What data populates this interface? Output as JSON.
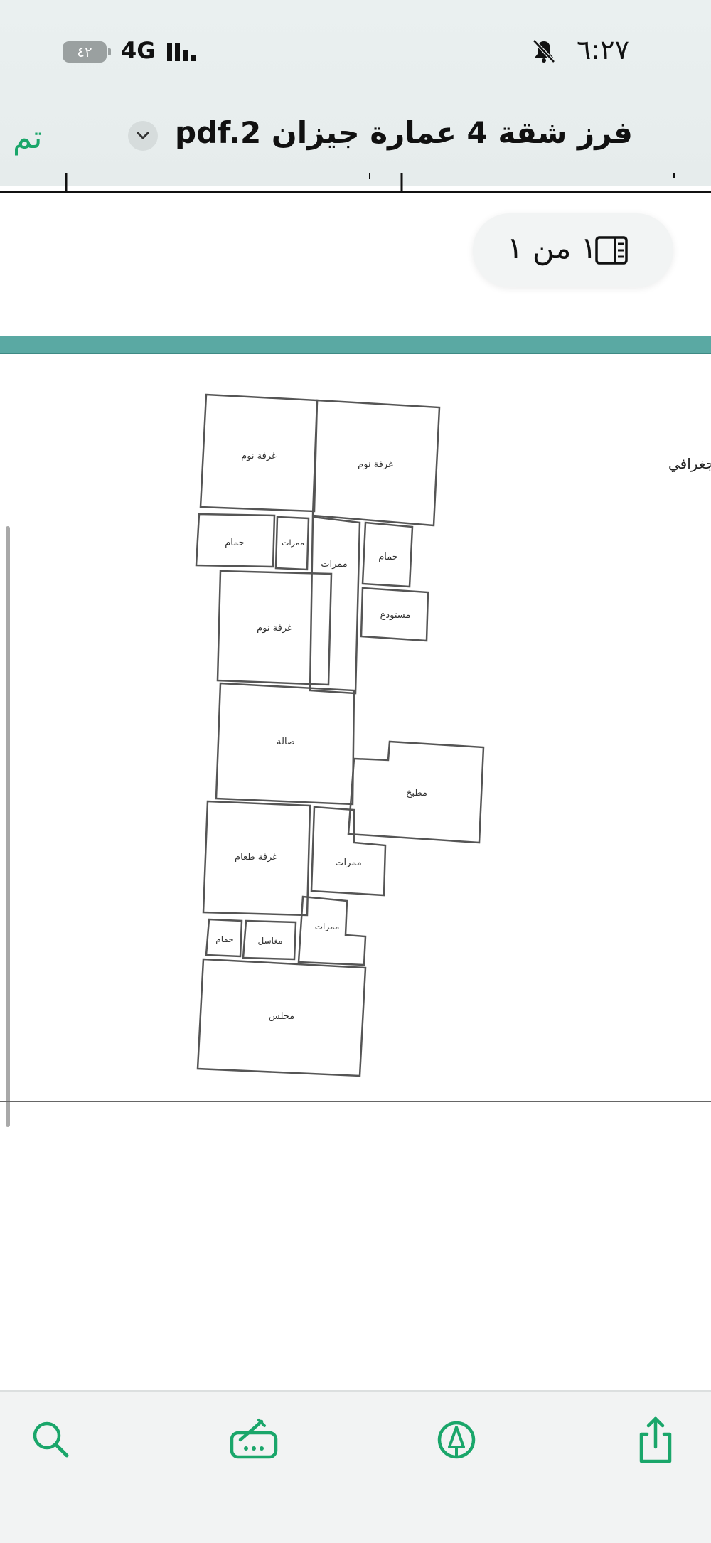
{
  "status_bar": {
    "time": "٦:٢٧",
    "network": "4G",
    "battery": "٤٢"
  },
  "header": {
    "done_label": "تم",
    "title": "فرز شقة 4 عمارة جيزان pdf.2"
  },
  "page_indicator": {
    "text": "١ من ١"
  },
  "document": {
    "side_label": "الجغرافي",
    "rooms": {
      "bedroom_1": "غرفة نوم",
      "bedroom_2": "غرفة نوم",
      "bath_1": "حمام",
      "corridor_1": "ممرات",
      "corridor_2": "ممرات",
      "bath_2": "حمام",
      "storage": "مستودع",
      "bedroom_3": "غرفة نوم",
      "hall": "صالة",
      "kitchen": "مطبخ",
      "dining": "غرفة طعام",
      "corridor_3": "ممرات",
      "bath_3": "حمام",
      "washbasins": "مغاسل",
      "corridor_4": "ممرات",
      "majlis": "مجلس"
    }
  },
  "toolbar": {
    "icons": [
      "search-icon",
      "scan-text-icon",
      "markup-icon",
      "share-icon"
    ]
  },
  "colors": {
    "accent": "#1aa66a",
    "band": "#5aa9a3"
  }
}
